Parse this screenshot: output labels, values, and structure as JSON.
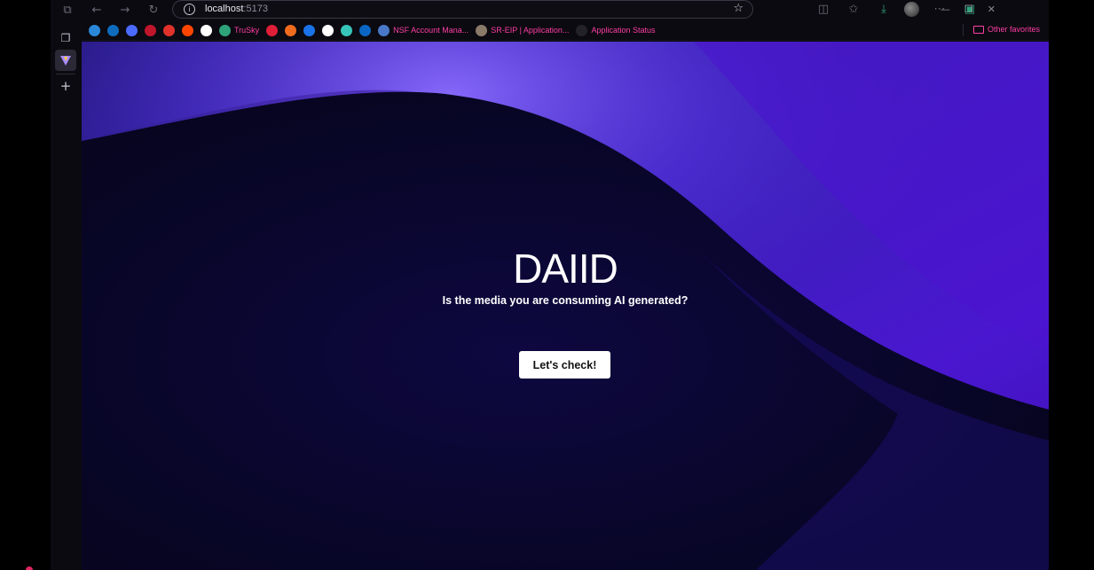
{
  "browser": {
    "address_bar": {
      "host": "localhost",
      "port": ":5173"
    },
    "bookmarks": [
      {
        "icon": "onedrive-icon",
        "color": "#2b88d8",
        "label": ""
      },
      {
        "icon": "outlook-icon",
        "color": "#0f6cbd",
        "label": ""
      },
      {
        "icon": "play-icon",
        "color": "#4b6bff",
        "label": ""
      },
      {
        "icon": "ou-logo-icon",
        "color": "#c0162c",
        "label": ""
      },
      {
        "icon": "asterisk-icon",
        "color": "#e0322a",
        "label": ""
      },
      {
        "icon": "reddit-icon",
        "color": "#ff4500",
        "label": ""
      },
      {
        "icon": "github-icon",
        "color": "#ffffff",
        "label": ""
      },
      {
        "icon": "globe-icon",
        "color": "#2ea37a",
        "label": "TruSky"
      },
      {
        "icon": "red-circle-icon",
        "color": "#e01e37",
        "label": ""
      },
      {
        "icon": "orange-circle-icon",
        "color": "#f06b1e",
        "label": ""
      },
      {
        "icon": "g-square-icon",
        "color": "#1a73e8",
        "label": ""
      },
      {
        "icon": "w-circle-icon",
        "color": "#ffffff",
        "label": ""
      },
      {
        "icon": "person-ring-icon",
        "color": "#37c5b9",
        "label": ""
      },
      {
        "icon": "linkedin-icon",
        "color": "#0a66c2",
        "label": ""
      },
      {
        "icon": "nsf-icon",
        "color": "#4a78c8",
        "label": "NSF Account Mana..."
      },
      {
        "icon": "figure-icon",
        "color": "#8a7a6a",
        "label": "SR-EIP | Application..."
      },
      {
        "icon": "dark-square-icon",
        "color": "#222228",
        "label": "Application Status"
      }
    ],
    "other_favorites": "Other favorites",
    "accent_color": "#ff3ea5"
  },
  "page": {
    "title": "DAIID",
    "subtitle": "Is the media you are consuming AI generated?",
    "cta_label": "Let's check!"
  }
}
